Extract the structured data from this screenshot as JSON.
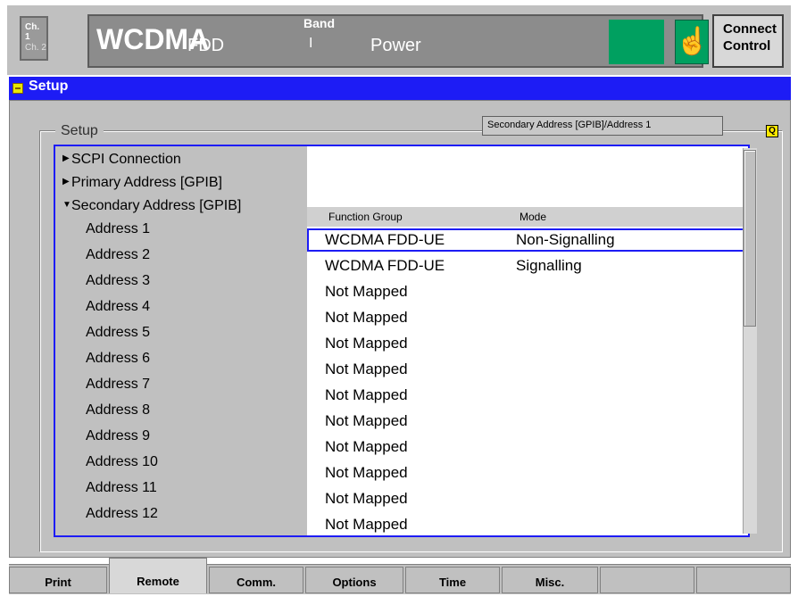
{
  "header": {
    "ch1": "Ch. 1",
    "ch2": "Ch. 2",
    "title": "WCDMA",
    "subtitle": "FDD",
    "band_label": "Band",
    "band_value": "I",
    "power_label": "Power",
    "connect_line1": "Connect",
    "connect_line2": "Control",
    "hand_icon": "hand-pointer-icon"
  },
  "setup_bar": {
    "label": "Setup"
  },
  "group": {
    "title": "Setup",
    "info": "Secondary Address [GPIB]/Address 1",
    "q_label": "Q"
  },
  "tree": {
    "scpi": "SCPI Connection",
    "primary": "Primary Address [GPIB]",
    "secondary": "Secondary Address [GPIB]",
    "addresses": [
      "Address 1",
      "Address 2",
      "Address 3",
      "Address 4",
      "Address 5",
      "Address 6",
      "Address 7",
      "Address 8",
      "Address 9",
      "Address 10",
      "Address 11",
      "Address 12"
    ]
  },
  "table": {
    "col1": "Function Group",
    "col2": "Mode",
    "rows": [
      {
        "group": "WCDMA FDD-UE",
        "mode": "Non-Signalling"
      },
      {
        "group": "WCDMA FDD-UE",
        "mode": "Signalling"
      },
      {
        "group": "Not Mapped",
        "mode": ""
      },
      {
        "group": "Not Mapped",
        "mode": ""
      },
      {
        "group": "Not Mapped",
        "mode": ""
      },
      {
        "group": "Not Mapped",
        "mode": ""
      },
      {
        "group": "Not Mapped",
        "mode": ""
      },
      {
        "group": "Not Mapped",
        "mode": ""
      },
      {
        "group": "Not Mapped",
        "mode": ""
      },
      {
        "group": "Not Mapped",
        "mode": ""
      },
      {
        "group": "Not Mapped",
        "mode": ""
      },
      {
        "group": "Not Mapped",
        "mode": ""
      }
    ]
  },
  "tabs": [
    "Print",
    "Remote",
    "Comm.",
    "Options",
    "Time",
    "Misc.",
    "",
    ""
  ],
  "active_tab": "Remote",
  "colors": {
    "accent_blue": "#1d1cf5",
    "status_green": "#00a060",
    "panel_gray": "#c0c0c0"
  }
}
